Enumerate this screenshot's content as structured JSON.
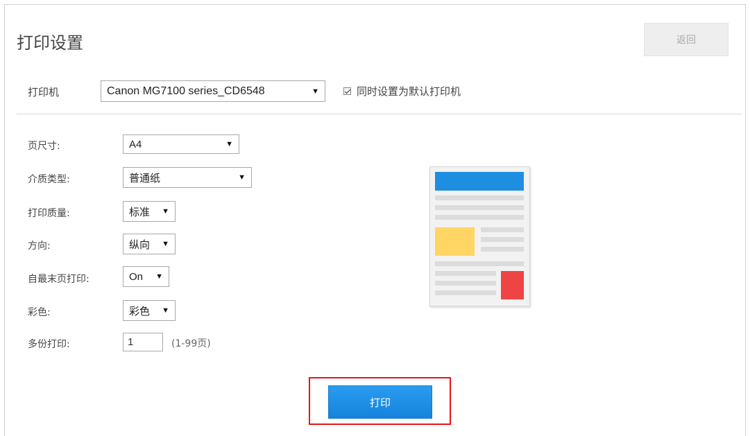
{
  "header": {
    "title": "打印设置",
    "back_label": "返回"
  },
  "printer": {
    "label": "打印机",
    "selected": "Canon MG7100 series_CD6548",
    "default_checkbox_label": "同时设置为默认打印机",
    "default_checked": true
  },
  "settings": {
    "page_size": {
      "label": "页尺寸:",
      "value": "A4"
    },
    "media_type": {
      "label": "介质类型:",
      "value": "普通纸"
    },
    "print_quality": {
      "label": "打印质量:",
      "value": "标准"
    },
    "orientation": {
      "label": "方向:",
      "value": "纵向"
    },
    "print_from_last": {
      "label": "自最末页打印:",
      "value": "On"
    },
    "color": {
      "label": "彩色:",
      "value": "彩色"
    },
    "copies": {
      "label": "多份打印:",
      "value": "1",
      "hint": "(1-99页)"
    }
  },
  "actions": {
    "print_label": "打印"
  },
  "colors": {
    "primary_blue": "#1e8ee0",
    "highlight_red": "#e81414",
    "preview_yellow": "#ffd563",
    "preview_red": "#ef4444"
  }
}
